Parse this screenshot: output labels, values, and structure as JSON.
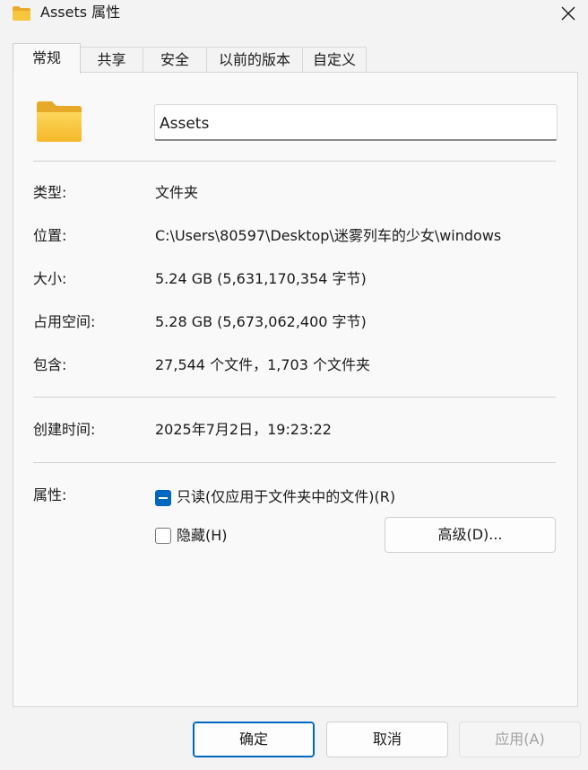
{
  "window": {
    "title": "Assets 属性",
    "close_icon": "close-icon"
  },
  "tabs": [
    {
      "label": "常规",
      "active": true
    },
    {
      "label": "共享",
      "active": false
    },
    {
      "label": "安全",
      "active": false
    },
    {
      "label": "以前的版本",
      "active": false
    },
    {
      "label": "自定义",
      "active": false
    }
  ],
  "general": {
    "folder_icon": "folder-icon",
    "name_value": "Assets",
    "rows": [
      {
        "label": "类型:",
        "value": "文件夹"
      },
      {
        "label": "位置:",
        "value": "C:\\Users\\80597\\Desktop\\迷雾列车的少女\\windows"
      },
      {
        "label": "大小:",
        "value": "5.24 GB (5,631,170,354 字节)"
      },
      {
        "label": "占用空间:",
        "value": "5.28 GB (5,673,062,400 字节)"
      },
      {
        "label": "包含:",
        "value": "27,544 个文件，1,703 个文件夹"
      }
    ],
    "created": {
      "label": "创建时间:",
      "value": "2025年7月2日，19:23:22"
    },
    "attributes": {
      "label": "属性:",
      "readonly": {
        "label": "只读(仅应用于文件夹中的文件)(R)",
        "state": "indeterminate"
      },
      "hidden": {
        "label": "隐藏(H)",
        "state": "unchecked"
      },
      "advanced_button": "高级(D)..."
    }
  },
  "footer": {
    "ok": "确定",
    "cancel": "取消",
    "apply": "应用(A)"
  },
  "colors": {
    "accent": "#0067c0",
    "folder": "#f8c63d"
  }
}
